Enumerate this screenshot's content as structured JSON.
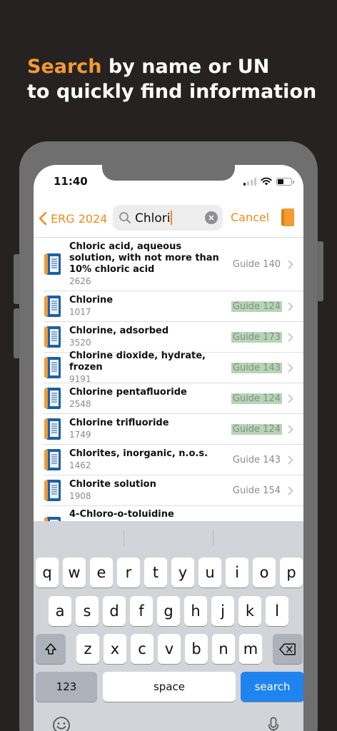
{
  "headline": {
    "accent": "Search",
    "rest": " by name or UN",
    "line2": "to quickly find information"
  },
  "status": {
    "time": "11:40"
  },
  "nav": {
    "back_label": "ERG 2024",
    "query": "Chlori",
    "cancel_label": "Cancel"
  },
  "results": [
    {
      "name": "Chloric acid, aqueous solution, with not more than 10% chloric acid",
      "un": "2626",
      "guide": "Guide 140",
      "highlight": false
    },
    {
      "name": "Chlorine",
      "un": "1017",
      "guide": "Guide 124",
      "highlight": true
    },
    {
      "name": "Chlorine, adsorbed",
      "un": "3520",
      "guide": "Guide 173",
      "highlight": true
    },
    {
      "name": "Chlorine dioxide, hydrate, frozen",
      "un": "9191",
      "guide": "Guide 143",
      "highlight": true
    },
    {
      "name": "Chlorine pentafluoride",
      "un": "2548",
      "guide": "Guide 124",
      "highlight": true
    },
    {
      "name": "Chlorine trifluoride",
      "un": "1749",
      "guide": "Guide 124",
      "highlight": true
    },
    {
      "name": "Chlorites, inorganic, n.o.s.",
      "un": "1462",
      "guide": "Guide 143",
      "highlight": false
    },
    {
      "name": "Chlorite solution",
      "un": "1908",
      "guide": "Guide 154",
      "highlight": false
    },
    {
      "name": "4-Chloro-o-toluidine",
      "un": "",
      "guide": "",
      "highlight": false
    }
  ],
  "keyboard": {
    "row1": [
      "q",
      "w",
      "e",
      "r",
      "t",
      "y",
      "u",
      "i",
      "o",
      "p"
    ],
    "row2": [
      "a",
      "s",
      "d",
      "f",
      "g",
      "h",
      "j",
      "k",
      "l"
    ],
    "row3": [
      "z",
      "x",
      "c",
      "v",
      "b",
      "n",
      "m"
    ],
    "numbers_label": "123",
    "space_label": "space",
    "search_label": "search"
  },
  "colors": {
    "accent": "#f08a1c",
    "background": "#262222",
    "highlight": "#b5d6b3",
    "search_key": "#1f84f0"
  }
}
